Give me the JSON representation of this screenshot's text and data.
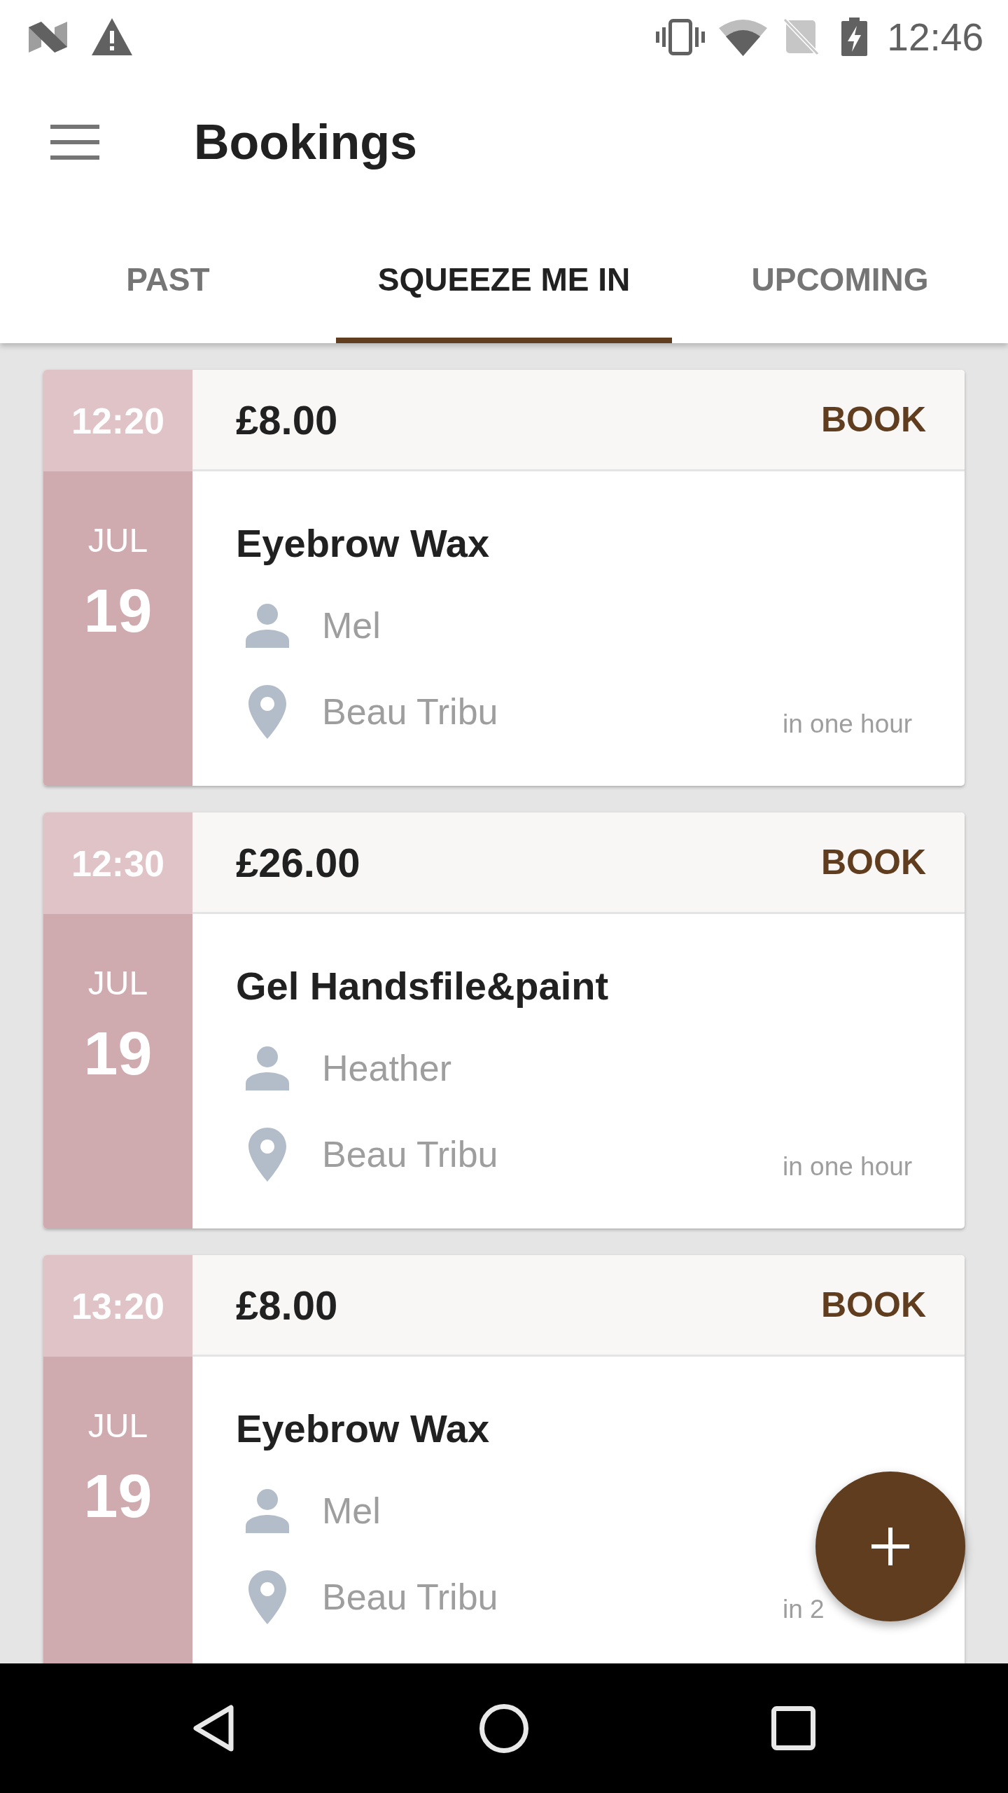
{
  "status_bar": {
    "time": "12:46"
  },
  "toolbar": {
    "title": "Bookings"
  },
  "tabs": [
    {
      "label": "PAST",
      "selected": false
    },
    {
      "label": "SQUEEZE ME IN",
      "selected": true
    },
    {
      "label": "UPCOMING",
      "selected": false
    }
  ],
  "bookings": [
    {
      "time": "12:20",
      "price": "£8.00",
      "action": "BOOK",
      "month": "JUL",
      "day": "19",
      "service": "Eyebrow Wax",
      "staff": "Mel",
      "location": "Beau Tribu",
      "when": "in one hour"
    },
    {
      "time": "12:30",
      "price": "£26.00",
      "action": "BOOK",
      "month": "JUL",
      "day": "19",
      "service": "Gel Handsfile&paint",
      "staff": "Heather",
      "location": "Beau Tribu",
      "when": "in one hour"
    },
    {
      "time": "13:20",
      "price": "£8.00",
      "action": "BOOK",
      "month": "JUL",
      "day": "19",
      "service": "Eyebrow Wax",
      "staff": "Mel",
      "location": "Beau Tribu",
      "when": "in 2"
    }
  ]
}
